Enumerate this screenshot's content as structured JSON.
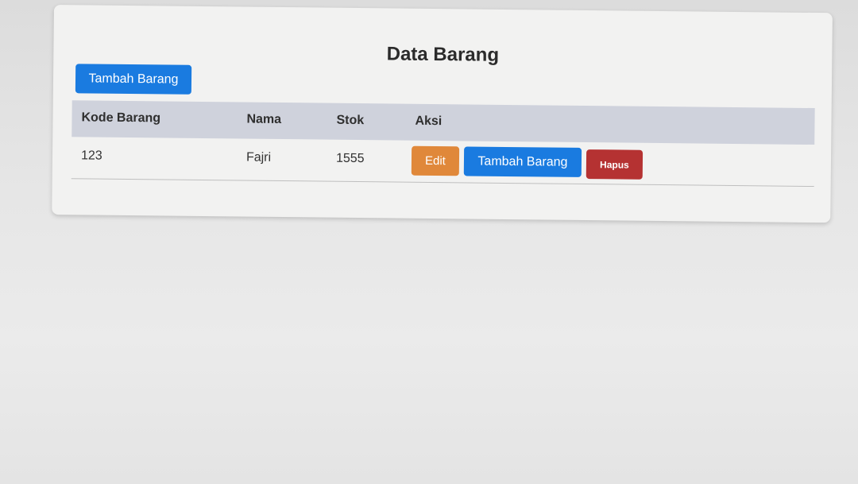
{
  "page": {
    "title": "Data Barang",
    "add_button_label": "Tambah Barang"
  },
  "table": {
    "headers": [
      "Kode Barang",
      "Nama",
      "Stok",
      "Aksi"
    ],
    "rows": [
      {
        "kode": "123",
        "nama": "Fajri",
        "stok": "1555",
        "actions": {
          "edit": "Edit",
          "add": "Tambah Barang",
          "delete": "Hapus"
        }
      }
    ]
  },
  "colors": {
    "primary": "#1a7be0",
    "warning": "#e0883a",
    "danger": "#b53232",
    "header_bg": "#cfd2dc"
  }
}
